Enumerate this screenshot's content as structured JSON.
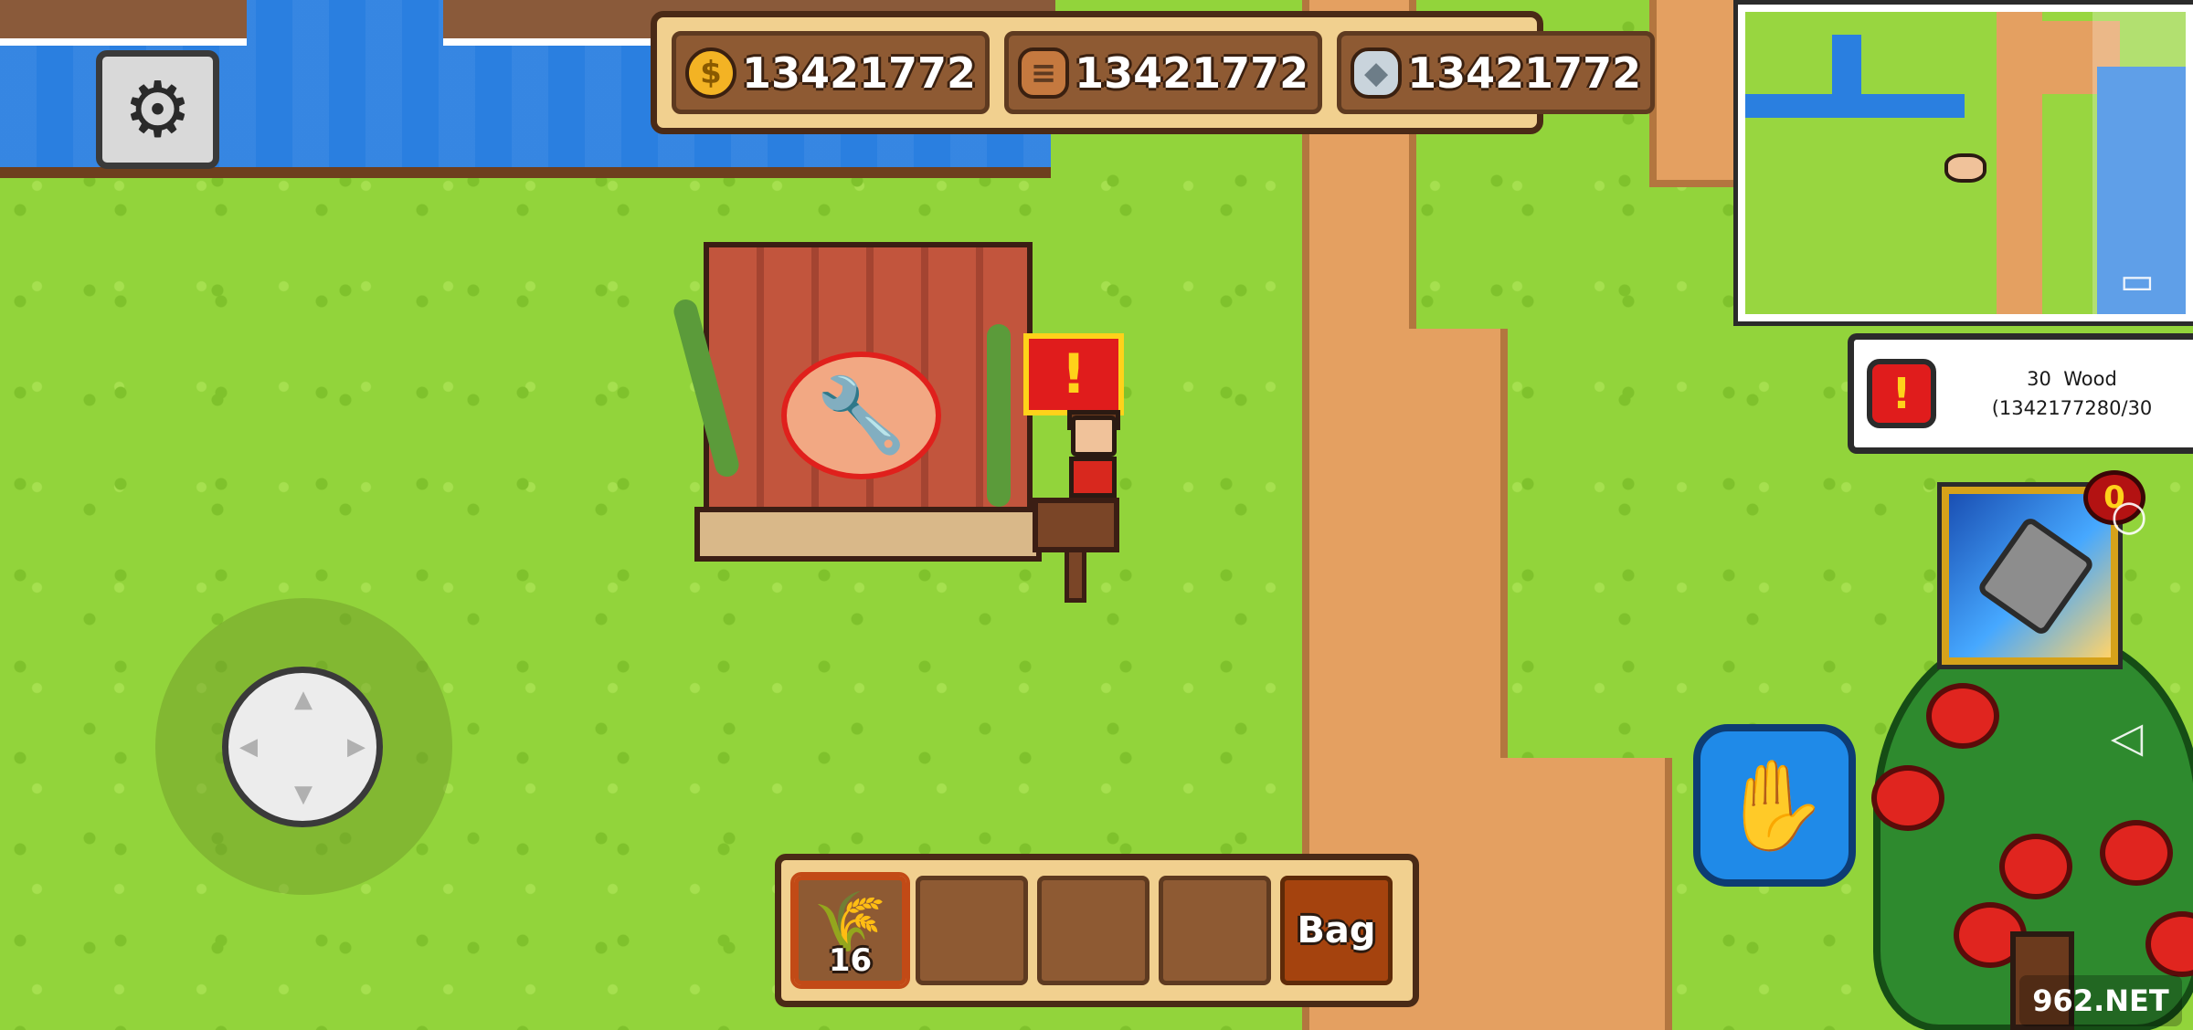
{
  "resources": {
    "gold": {
      "icon": "gold-coin-icon",
      "value": "13421772"
    },
    "wood": {
      "icon": "wood-log-icon",
      "value": "13421772"
    },
    "stone": {
      "icon": "stone-icon",
      "value": "13421772"
    }
  },
  "settings": {
    "icon": "gear-icon"
  },
  "quest": {
    "icon": "alert-icon",
    "text": "30  Wood\n(1342177280/30"
  },
  "skill": {
    "icon": "axe-chop-icon",
    "badge": "0"
  },
  "interact": {
    "icon": "hand-icon"
  },
  "hotbar": {
    "slots": [
      {
        "item_icon": "wheat-icon",
        "count": "16"
      },
      {
        "item_icon": "",
        "count": ""
      },
      {
        "item_icon": "",
        "count": ""
      },
      {
        "item_icon": "",
        "count": ""
      }
    ],
    "bag_label": "Bag"
  },
  "watermark": "962.NET",
  "colors": {
    "grass": "#92d43b",
    "water": "#2a7fe0",
    "dirt_path": "#e4a061",
    "hud_frame": "#f1d08f",
    "hud_slot": "#8e5a33",
    "alert_red": "#e01c1c"
  }
}
